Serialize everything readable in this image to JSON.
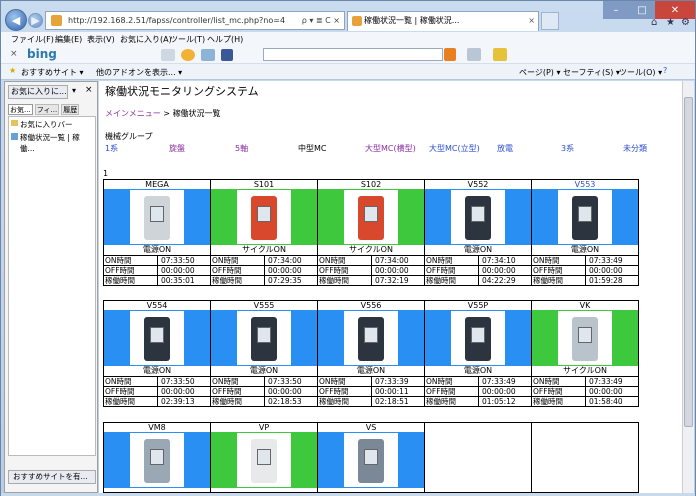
{
  "browser": {
    "url": "http://192.168.2.51/fapss/controller/list_mc.php?no=4",
    "addr_controls": "ρ ▾ ≣ C ×",
    "tab_title": "稼働状況一覧 | 稼働状況...",
    "menu": [
      "ファイル(F)",
      "編集(E)",
      "表示(V)",
      "お気に入り(A)",
      "ツール(T)",
      "ヘルプ(H)"
    ],
    "bing": "bing",
    "fav": {
      "suggest": "おすすめサイト ▾",
      "addon": "他のアドオンを表示... ▾"
    },
    "cmd": {
      "page": "ページ(P) ▾",
      "safety": "セーフティ(S) ▾",
      "tools": "ツール(O) ▾"
    }
  },
  "sidebar": {
    "add_btn": "お気に入りに...",
    "tabs": [
      "お気...",
      "フィ...",
      "履歴"
    ],
    "items": [
      "お気に入りバー",
      "稼働状況一覧 | 稼働..."
    ],
    "footer": "おすすめサイトを有..."
  },
  "page": {
    "title": "稼働状況モニタリングシステム",
    "crumb_link": "メインメニュー",
    "crumb_sep": " > ",
    "crumb_current": "稼働状況一覧",
    "group_label": "機械グループ",
    "categories": [
      {
        "label": "1系",
        "style": "lnk"
      },
      {
        "label": "旋盤",
        "style": "pur"
      },
      {
        "label": "5軸",
        "style": "pur"
      },
      {
        "label": "中型MC",
        "style": "plain"
      },
      {
        "label": "大型MC(横型)",
        "style": "pur"
      },
      {
        "label": "大型MC(立型)",
        "style": "lnk"
      },
      {
        "label": "放電",
        "style": "lnk"
      },
      {
        "label": "3系",
        "style": "lnk"
      },
      {
        "label": "未分類",
        "style": "lnk"
      }
    ],
    "row_number": "1",
    "labels": {
      "on": "ON時間",
      "off": "OFF時間",
      "run": "稼働時間"
    }
  },
  "machines": [
    {
      "name": "MEGA",
      "status": "電源ON",
      "color": "#2a8ff2",
      "body": "#cfd4d9",
      "on": "07:33:50",
      "off": "00:00:00",
      "run": "00:35:01"
    },
    {
      "name": "S101",
      "status": "サイクルON",
      "color": "#3ec83e",
      "body": "#d8482c",
      "on": "07:34:00",
      "off": "00:00:00",
      "run": "07:29:35"
    },
    {
      "name": "S102",
      "status": "サイクルON",
      "color": "#3ec83e",
      "body": "#d8482c",
      "on": "07:34:00",
      "off": "00:00:00",
      "run": "07:32:19"
    },
    {
      "name": "V552",
      "status": "電源ON",
      "color": "#2a8ff2",
      "body": "#2c3440",
      "on": "07:34:10",
      "off": "00:00:00",
      "run": "04:22:29"
    },
    {
      "name": "V553",
      "status": "電源ON",
      "color": "#2a8ff2",
      "body": "#2c3440",
      "on": "07:33:49",
      "off": "00:00:00",
      "run": "01:59:28",
      "link": true
    },
    {
      "name": "V554",
      "status": "電源ON",
      "color": "#2a8ff2",
      "body": "#2c3440",
      "on": "07:33:50",
      "off": "00:00:00",
      "run": "02:39:13"
    },
    {
      "name": "V555",
      "status": "電源ON",
      "color": "#2a8ff2",
      "body": "#2c3440",
      "on": "07:33:50",
      "off": "00:00:00",
      "run": "02:18:53"
    },
    {
      "name": "V556",
      "status": "電源ON",
      "color": "#2a8ff2",
      "body": "#2c3440",
      "on": "07:33:39",
      "off": "00:00:11",
      "run": "02:18:51"
    },
    {
      "name": "V55P",
      "status": "電源ON",
      "color": "#2a8ff2",
      "body": "#2c3440",
      "on": "07:33:49",
      "off": "00:00:00",
      "run": "01:05:12"
    },
    {
      "name": "VK",
      "status": "サイクルON",
      "color": "#3ec83e",
      "body": "#b9c3cc",
      "on": "07:33:49",
      "off": "00:00:00",
      "run": "01:58:40"
    },
    {
      "name": "VM8",
      "status": "",
      "color": "#2a8ff2",
      "body": "#9aa7b4",
      "on": "",
      "off": "",
      "run": ""
    },
    {
      "name": "VP",
      "status": "",
      "color": "#3ec83e",
      "body": "#e7e9eb",
      "on": "",
      "off": "",
      "run": ""
    },
    {
      "name": "VS",
      "status": "",
      "color": "#2a8ff2",
      "body": "#7a8898",
      "on": "",
      "off": "",
      "run": ""
    }
  ]
}
